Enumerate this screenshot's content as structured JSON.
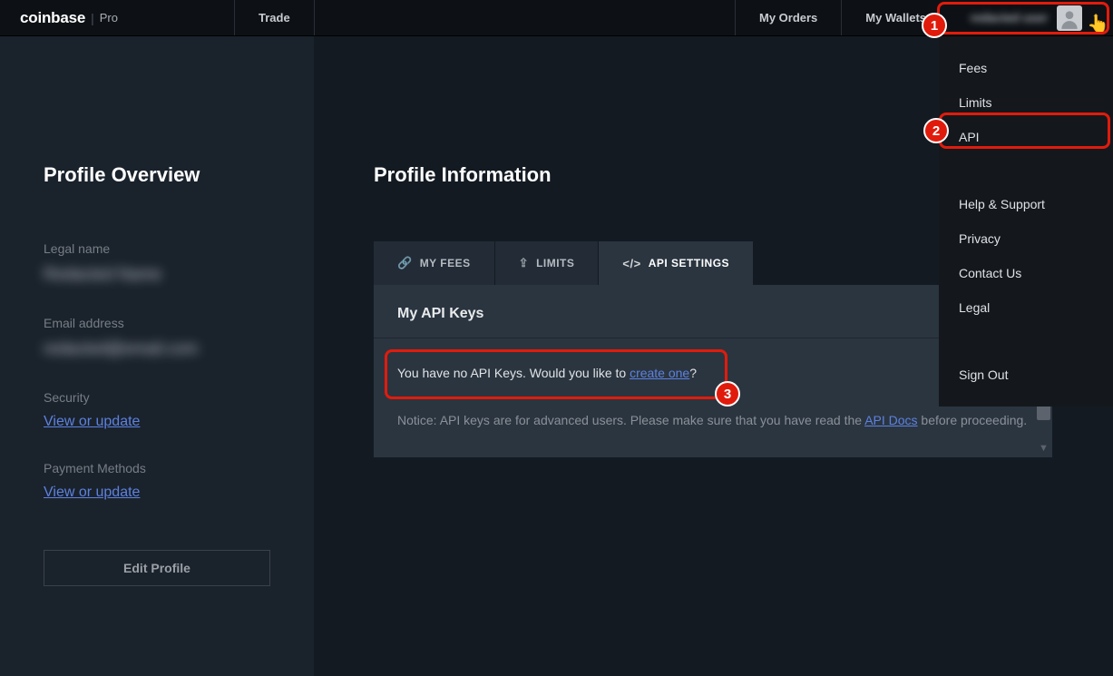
{
  "brand": {
    "name": "coinbase",
    "suffix": "Pro"
  },
  "topnav": {
    "trade": "Trade",
    "my_orders": "My Orders",
    "my_wallets": "My Wallets",
    "user_name": "redacted user"
  },
  "dropdown": {
    "fees": "Fees",
    "limits": "Limits",
    "api": "API",
    "help": "Help & Support",
    "privacy": "Privacy",
    "contact": "Contact Us",
    "legal": "Legal",
    "signout": "Sign Out"
  },
  "sidebar": {
    "title": "Profile Overview",
    "legal_name_label": "Legal name",
    "legal_name_value": "Redacted Name",
    "email_label": "Email address",
    "email_value": "redacted@email.com",
    "security_label": "Security",
    "security_link": "View or update",
    "payment_label": "Payment Methods",
    "payment_link": "View or update",
    "edit_btn": "Edit Profile"
  },
  "main": {
    "title": "Profile Information",
    "tabs": {
      "fees": "MY FEES",
      "limits": "LIMITS",
      "api": "API SETTINGS"
    },
    "panel": {
      "title": "My API Keys",
      "add": "+",
      "none_prefix": "You have no API Keys. Would you like to ",
      "none_link": "create one",
      "none_suffix": "?",
      "notice_prefix": "Notice: API keys are for advanced users. Please make sure that you have read the ",
      "notice_link": "API Docs",
      "notice_suffix": " before proceeding."
    }
  },
  "callouts": {
    "c1": "1",
    "c2": "2",
    "c3": "3"
  }
}
